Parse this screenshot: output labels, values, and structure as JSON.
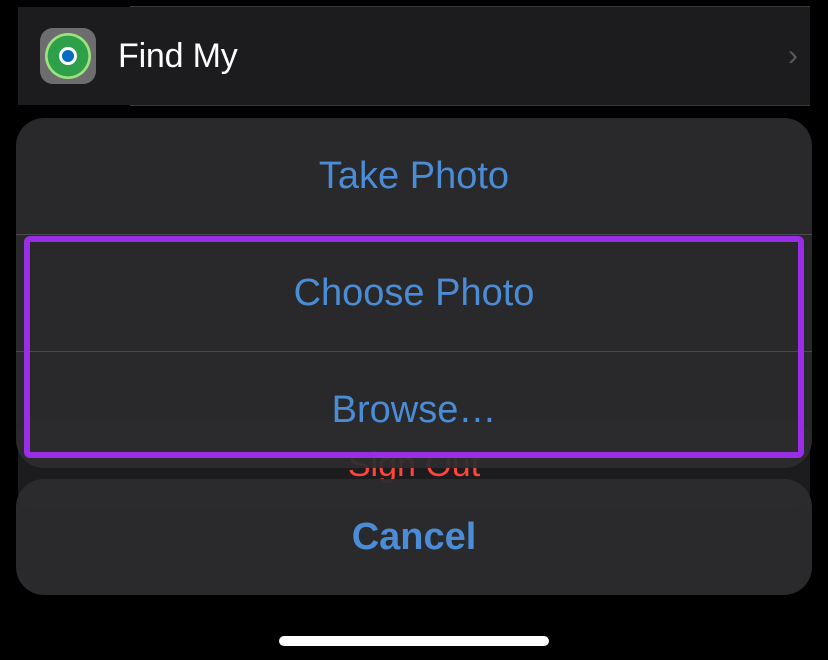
{
  "background": {
    "find_my_label": "Find My",
    "sign_out_label": "Sign Out"
  },
  "action_sheet": {
    "take_photo": "Take Photo",
    "choose_photo": "Choose Photo",
    "browse": "Browse…",
    "cancel": "Cancel"
  }
}
